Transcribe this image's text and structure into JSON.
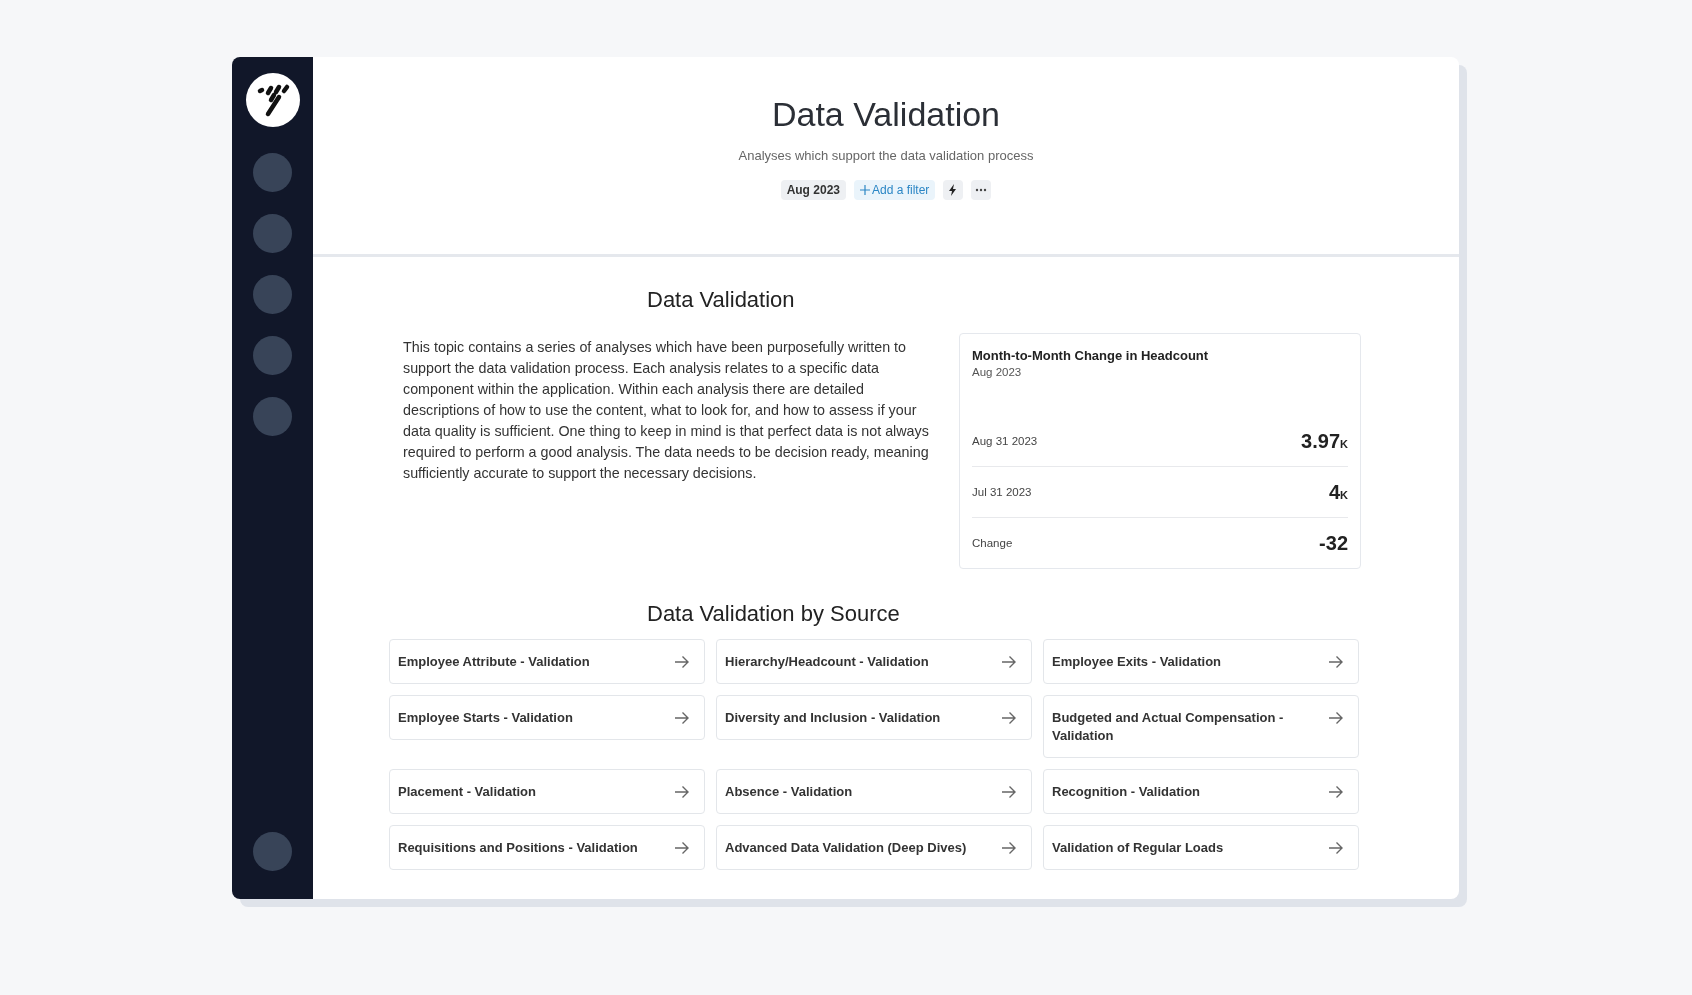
{
  "header": {
    "title": "Data Validation",
    "subtitle": "Analyses which support the data validation process",
    "filters": [
      {
        "kind": "chip",
        "label": "Aug 2023"
      },
      {
        "kind": "add",
        "label": "Add a filter"
      }
    ]
  },
  "intro": {
    "title": "Data Validation",
    "text": "This topic contains a series of analyses which have been purposefully written to support the data validation process. Each analysis relates to a specific data component within the application. Within each analysis there are detailed descriptions of how to use the content, what to look for, and how to assess if your data quality is sufficient. One thing to keep in mind is that perfect data is not always required to perform a good analysis. The data needs to be decision ready, meaning sufficiently accurate to support the necessary decisions."
  },
  "metric_card": {
    "title": "Month-to-Month Change in Headcount",
    "period": "Aug 2023",
    "rows": [
      {
        "label": "Aug 31 2023",
        "value": "3.97",
        "unit": "K"
      },
      {
        "label": "Jul 31 2023",
        "value": "4",
        "unit": "K"
      },
      {
        "label": "Change",
        "value": "-32"
      }
    ]
  },
  "sources": {
    "title": "Data Validation by Source",
    "items": [
      "Employee Attribute - Validation",
      "Hierarchy/Headcount - Validation",
      "Employee Exits - Validation",
      "Employee Starts - Validation",
      "Diversity and Inclusion - Validation",
      "Budgeted and Actual Compensation - Validation",
      "Placement - Validation",
      "Absence - Validation",
      "Recognition - Validation",
      "Requisitions and Positions - Validation",
      "Advanced Data Validation (Deep Dives)",
      "Validation of Regular Loads"
    ]
  }
}
